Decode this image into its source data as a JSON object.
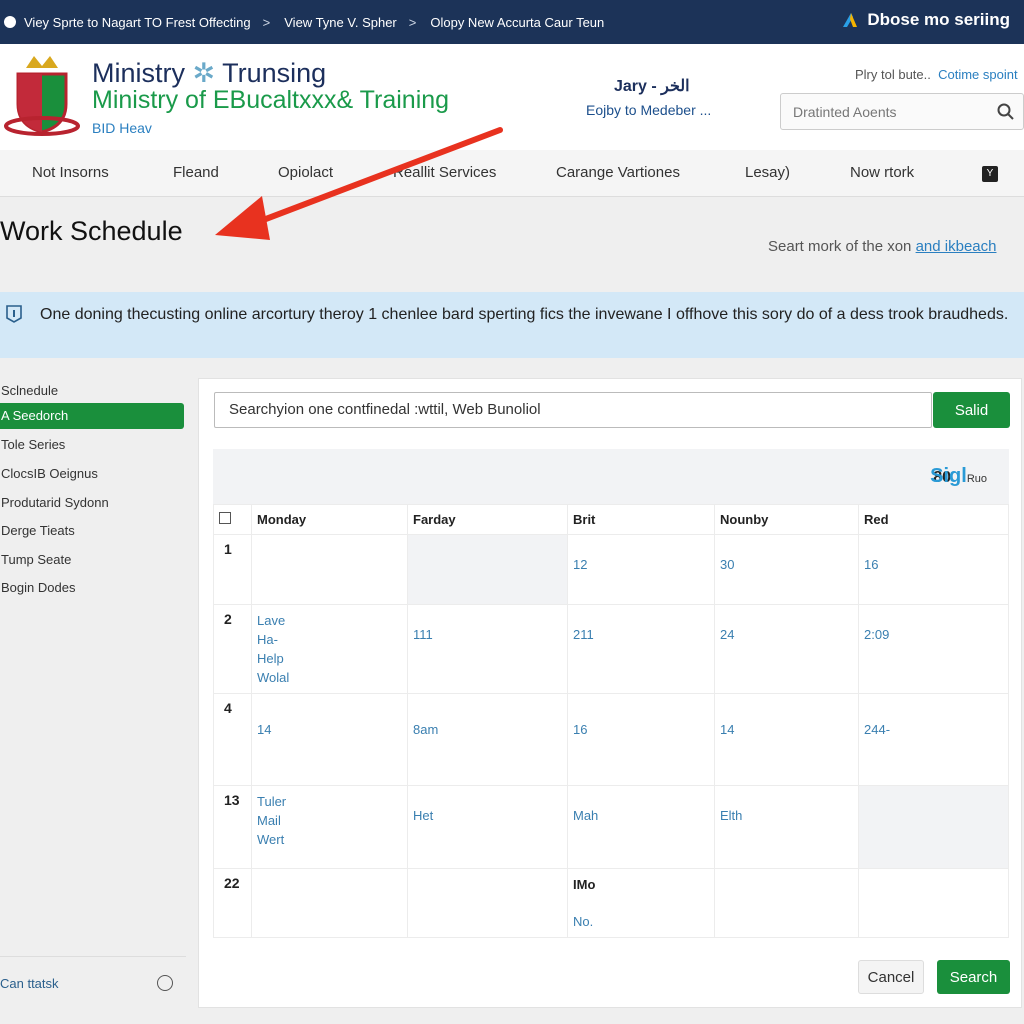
{
  "topbar": {
    "crumbs": [
      "Viey Sprte to Nagart TO Frest Offecting",
      "View Tyne V. Spher",
      "Olopy New Accurta Caur Teun"
    ],
    "right": "Dbose mo seriing"
  },
  "header": {
    "title_line1": "Ministry",
    "title_line1b": "Trunsing",
    "title_line2": "Ministry of EBucaltxxx& Training",
    "subtitle": "BID Heav",
    "user_name": "Jary - الخر",
    "user_sub": "Eojby to Medeber ...",
    "links_text": "Plry tol bute..",
    "links_link": "Cotime spoint",
    "search_placeholder": "Dratinted Aoents"
  },
  "nav": [
    "Not Insorns",
    "Fleand",
    "Opiolact",
    "Reallit Services",
    "Carange Vartiones",
    "Lesay)",
    "Now rtork"
  ],
  "page": {
    "title": "Work Schedule",
    "right_text": "Seart mork of the xon",
    "right_link": "and ikbeach"
  },
  "banner": {
    "text": "One doning thecusting online arcortury theroy 1 chenlee bard sperting fics the invewane I offhove this sory do of a dess trook braudheds."
  },
  "sidebar": {
    "items": [
      "Sclnedule",
      "A Seedorch",
      "Tole Series",
      "ClocsIB Oeignus",
      "Produtarid Sydonn",
      "Derge Tieats",
      "Tump Seate",
      "Bogin Dodes"
    ],
    "active_index": 1,
    "footer": "Can ttatsk"
  },
  "panel": {
    "search_value": "Searchyion one contfinedal :wttil, Web Bunoliol",
    "search_button": "Salid",
    "count": "80",
    "brand": "Sigl",
    "brand_small": "Ruo",
    "columns": [
      "Monday",
      "Farday",
      "Brit",
      "Nounby",
      "Red"
    ],
    "rows": [
      {
        "num": "1",
        "cells": [
          [],
          [],
          [
            "12"
          ],
          [
            "30"
          ],
          [
            "16"
          ]
        ]
      },
      {
        "num": "2",
        "cells": [
          [
            "Lave",
            "Ha-",
            "Help",
            "Wolal"
          ],
          [
            "111"
          ],
          [
            "211"
          ],
          [
            "24"
          ],
          [
            "2:09"
          ]
        ]
      },
      {
        "num": "4",
        "cells": [
          [
            "14"
          ],
          [
            "8am"
          ],
          [
            "16"
          ],
          [
            "14"
          ],
          [
            "244-"
          ]
        ]
      },
      {
        "num": "13",
        "cells": [
          [
            "Tuler",
            "Mail",
            "Wert"
          ],
          [
            "Het"
          ],
          [
            "Mah"
          ],
          [
            "Elth"
          ],
          []
        ]
      },
      {
        "num": "22",
        "cells": [
          [],
          [],
          [
            "IMo",
            "No."
          ],
          [],
          []
        ]
      }
    ],
    "cancel": "Cancel",
    "search": "Search"
  },
  "colors": {
    "topbar": "#1c3358",
    "accent_green": "#1a8f3c",
    "banner": "#d3e8f7",
    "link": "#2a7fc0",
    "arrow": "#e8321f"
  }
}
